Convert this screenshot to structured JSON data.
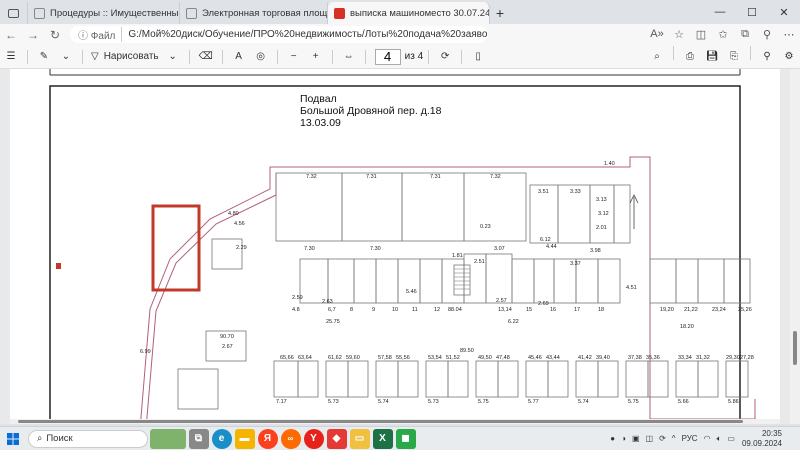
{
  "tabs": [
    {
      "title": "Процедуры :: Имущественные т"
    },
    {
      "title": "Электронная торговая площадк"
    },
    {
      "title": "выписка машиноместо 30.07.24"
    }
  ],
  "address": {
    "label": "Файл",
    "url": "G:/Мой%20диск/Обучение/ПРО%20недвижимость/Лоты%20подача%20заявок/ММ%20Большо..."
  },
  "pdf_toolbar": {
    "draw_label": "Нарисовать",
    "page_value": "4",
    "page_total": "из 4",
    "zoom_minus": "−",
    "zoom_plus": "+",
    "font_label": "A"
  },
  "document": {
    "title_line1": "Подвал",
    "title_line2": "Большой  Дровяной пер. д.18",
    "title_line3": "13.03.09",
    "top_dims": [
      "7.32",
      "7.31",
      "7.31",
      "7.32"
    ],
    "row_dims": [
      "7.30",
      "7.30",
      "3.07"
    ],
    "mid_numbers": [
      "4.8",
      "6,7",
      "8",
      "9",
      "10",
      "11",
      "12",
      "88.04",
      "13,14",
      "15",
      "16",
      "17",
      "18",
      "19,20",
      "21,22",
      "23,24",
      "25,26"
    ],
    "lower_numbers": [
      "65,66",
      "63,64",
      "61,62",
      "59,60",
      "57,58",
      "55,56",
      "53,54",
      "51,52",
      "49,50",
      "47,48",
      "45,46",
      "43,44",
      "41,42",
      "39,40",
      "37,38",
      "35,36",
      "33,34",
      "31,32",
      "29,30",
      "27,28"
    ],
    "lower_dims": [
      "7.17",
      "5.73",
      "5.74",
      "5.73",
      "5.75",
      "5.77",
      "5.74",
      "5.75",
      "5.66",
      "5.86"
    ],
    "misc_dims": [
      "1.40",
      "3.51",
      "3.33",
      "3.13",
      "3.12",
      "2.01",
      "4.80",
      "4.56",
      "2.29",
      "2.59",
      "2.63",
      "5.46",
      "1.81",
      "2.51",
      "2.57",
      "2.69",
      "4.44",
      "3.37",
      "3.98",
      "4.51",
      "6.12",
      "0.23",
      "6.22",
      "25.75",
      "18.20",
      "89.50",
      "90.70",
      "2.67",
      "6.99"
    ]
  },
  "taskbar": {
    "search_label": "Поиск",
    "lang": "РУС",
    "time": "20:35",
    "date": "09.09.2024"
  },
  "colors": {
    "highlight": "#c0392b",
    "plan_line": "#b0607a",
    "pdf_red": "#d93025"
  }
}
